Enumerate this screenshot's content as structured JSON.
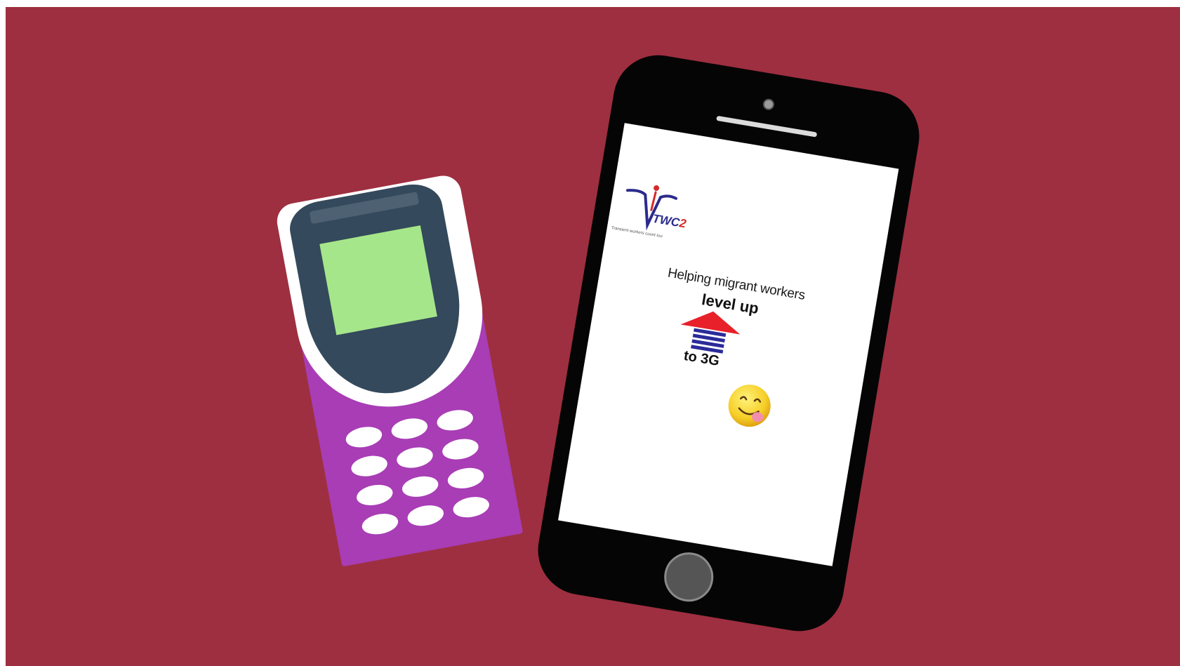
{
  "scene": {
    "background_color": "#9e2f40",
    "feature_phone": {
      "body_color": "#a83db5",
      "screen_color": "#a6e68a",
      "bezel_color": "#34495b",
      "key_count": 12
    },
    "smartphone": {
      "logo": {
        "wordmark": "TWC",
        "wordmark_digit": "2",
        "tagline": "Transient workers count too",
        "icon": "twc2-logo-icon"
      },
      "headline": "Helping migrant workers",
      "emphasis": "level up",
      "arrow_icon": "up-arrow-icon",
      "target": "to 3G",
      "emoji_icon": "smiling-face-tongue-emoji"
    }
  }
}
